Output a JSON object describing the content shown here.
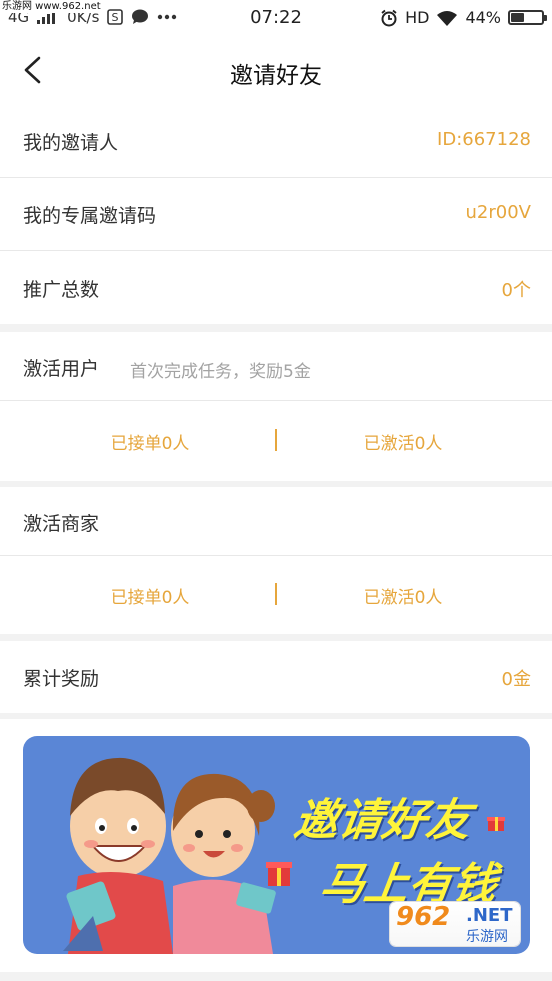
{
  "status_bar": {
    "watermark_text": "乐游网 www.962.net",
    "network": "4G",
    "speed": "0K/s",
    "time": "07:22",
    "hd_label": "HD",
    "battery_percent": "44%",
    "battery_level": 0.44
  },
  "header": {
    "title": "邀请好友"
  },
  "rows": {
    "inviter": {
      "label": "我的邀请人",
      "value": "ID:667128"
    },
    "invite_code": {
      "label": "我的专属邀请码",
      "value": "u2r00V"
    },
    "promo_total": {
      "label": "推广总数",
      "value": "0个"
    }
  },
  "active_users": {
    "label": "激活用户",
    "hint": "首次完成任务，奖励5金",
    "orders_taken": "已接单0人",
    "activated": "已激活0人"
  },
  "active_merchants": {
    "label": "激活商家",
    "orders_taken": "已接单0人",
    "activated": "已激活0人"
  },
  "total_reward": {
    "label": "累计奖励",
    "value": "0金"
  },
  "banner": {
    "line1": "邀请好友",
    "line2": "马上有钱",
    "watermark_number": "962",
    "watermark_net": ".NET",
    "watermark_cn": "乐游网"
  },
  "colors": {
    "accent": "#e6a63c",
    "banner_bg": "#5a86d6",
    "banner_text": "#fff43a"
  }
}
